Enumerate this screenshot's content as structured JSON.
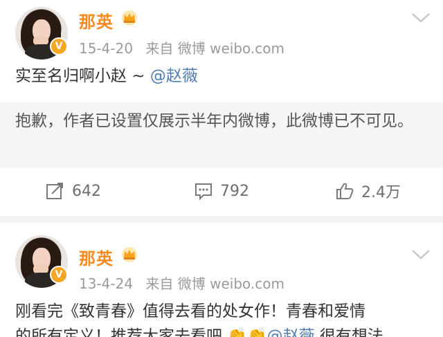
{
  "posts": [
    {
      "author": "那英",
      "date": "15-4-20",
      "source_prefix": "来自",
      "source": "微博 weibo.com",
      "content_text": "实至名归啊小赵 ~ ",
      "mention": "@赵薇",
      "notice": "抱歉，作者已设置仅展示半年内微博，此微博已不可见。",
      "stats": {
        "repost": "642",
        "comment": "792",
        "like": "2.4万"
      }
    },
    {
      "author": "那英",
      "date": "13-4-24",
      "source_prefix": "来自",
      "source": "微博 weibo.com",
      "content_line1": "刚看完《致青春》值得去看的处女作！青春和爱情",
      "content_line2_pre": "的所有定义！推荐大家去看吧",
      "content_line2_mention": "@赵薇",
      "content_line2_post": " 很有想法"
    }
  ],
  "colors": {
    "name": "#f58a1f",
    "mention": "#4f7cb5",
    "meta": "#9a9a9a",
    "notice_bg": "#f5f5f5",
    "divider": "#f2f2f2"
  },
  "icons": {
    "verified": "verified-v-badge",
    "crown": "crown-icon",
    "chevron": "chevron-down-icon",
    "repost": "repost-icon",
    "comment": "comment-icon",
    "like": "thumbs-up-icon"
  }
}
